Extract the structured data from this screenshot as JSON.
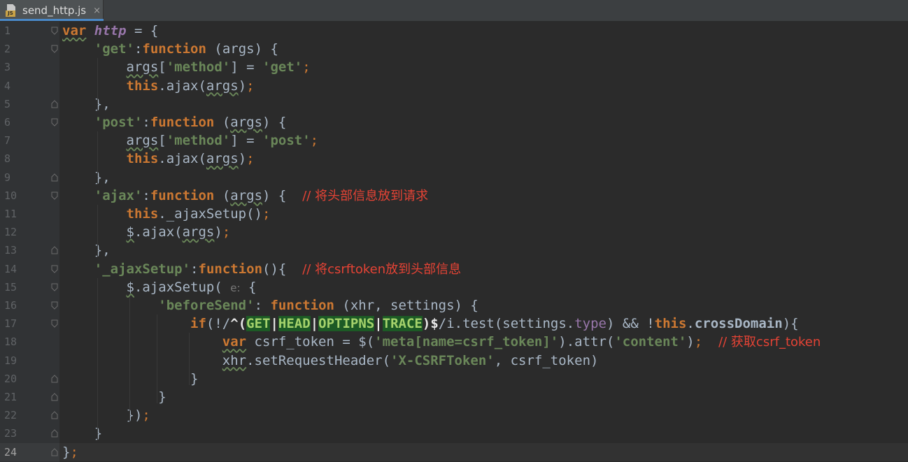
{
  "tab": {
    "filename": "send_http.js",
    "icon_badge": "JS",
    "close_glyph": "×"
  },
  "editor": {
    "current_line": 24,
    "lines": [
      {
        "n": "1",
        "tokens": [
          {
            "t": "var",
            "c": "kw wavy"
          },
          {
            "t": " "
          },
          {
            "t": "http",
            "c": "var"
          },
          {
            "t": " = {"
          }
        ]
      },
      {
        "n": "2",
        "tokens": [
          {
            "t": "    "
          },
          {
            "t": "'get'",
            "c": "str"
          },
          {
            "t": ":"
          },
          {
            "t": "function",
            "c": "kw"
          },
          {
            "t": " ("
          },
          {
            "t": "args"
          },
          {
            "t": ") {"
          }
        ]
      },
      {
        "n": "3",
        "tokens": [
          {
            "t": "        "
          },
          {
            "t": "args",
            "c": "wavy"
          },
          {
            "t": "["
          },
          {
            "t": "'method'",
            "c": "str"
          },
          {
            "t": "] = "
          },
          {
            "t": "'get'",
            "c": "str"
          },
          {
            "t": ";",
            "c": "kw2"
          }
        ]
      },
      {
        "n": "4",
        "tokens": [
          {
            "t": "        "
          },
          {
            "t": "this",
            "c": "kw"
          },
          {
            "t": ".ajax("
          },
          {
            "t": "args",
            "c": "wavy"
          },
          {
            "t": ")"
          },
          {
            "t": ";",
            "c": "kw2"
          }
        ]
      },
      {
        "n": "5",
        "tokens": [
          {
            "t": "    },"
          }
        ]
      },
      {
        "n": "6",
        "tokens": [
          {
            "t": "    "
          },
          {
            "t": "'post'",
            "c": "str"
          },
          {
            "t": ":"
          },
          {
            "t": "function",
            "c": "kw"
          },
          {
            "t": " ("
          },
          {
            "t": "args",
            "c": "wavy"
          },
          {
            "t": ") {"
          }
        ]
      },
      {
        "n": "7",
        "tokens": [
          {
            "t": "        "
          },
          {
            "t": "args",
            "c": "wavy"
          },
          {
            "t": "["
          },
          {
            "t": "'method'",
            "c": "str"
          },
          {
            "t": "] = "
          },
          {
            "t": "'post'",
            "c": "str"
          },
          {
            "t": ";",
            "c": "kw2"
          }
        ]
      },
      {
        "n": "8",
        "tokens": [
          {
            "t": "        "
          },
          {
            "t": "this",
            "c": "kw"
          },
          {
            "t": ".ajax("
          },
          {
            "t": "args",
            "c": "wavy"
          },
          {
            "t": ")"
          },
          {
            "t": ";",
            "c": "kw2"
          }
        ]
      },
      {
        "n": "9",
        "tokens": [
          {
            "t": "    },"
          }
        ]
      },
      {
        "n": "10",
        "tokens": [
          {
            "t": "    "
          },
          {
            "t": "'ajax'",
            "c": "str"
          },
          {
            "t": ":"
          },
          {
            "t": "function",
            "c": "kw"
          },
          {
            "t": " ("
          },
          {
            "t": "args",
            "c": "wavy"
          },
          {
            "t": ") {  "
          },
          {
            "t": "// 将头部信息放到请求",
            "c": "cmt"
          }
        ]
      },
      {
        "n": "11",
        "tokens": [
          {
            "t": "        "
          },
          {
            "t": "this",
            "c": "kw"
          },
          {
            "t": "._ajaxSetup()"
          },
          {
            "t": ";",
            "c": "kw2"
          }
        ]
      },
      {
        "n": "12",
        "tokens": [
          {
            "t": "        "
          },
          {
            "t": "$",
            "c": "wavy"
          },
          {
            "t": ".ajax("
          },
          {
            "t": "args",
            "c": "wavy"
          },
          {
            "t": ")"
          },
          {
            "t": ";",
            "c": "kw2"
          }
        ]
      },
      {
        "n": "13",
        "tokens": [
          {
            "t": "    },"
          }
        ]
      },
      {
        "n": "14",
        "tokens": [
          {
            "t": "    "
          },
          {
            "t": "'_ajaxSetup'",
            "c": "str"
          },
          {
            "t": ":"
          },
          {
            "t": "function",
            "c": "kw"
          },
          {
            "t": "(){  "
          },
          {
            "t": "// 将csrftoken放到头部信息",
            "c": "cmt"
          }
        ]
      },
      {
        "n": "15",
        "tokens": [
          {
            "t": "        "
          },
          {
            "t": "$",
            "c": "wavy"
          },
          {
            "t": ".ajaxSetup( "
          },
          {
            "t": "e:",
            "c": "hint"
          },
          {
            "t": " {"
          }
        ]
      },
      {
        "n": "16",
        "tokens": [
          {
            "t": "            "
          },
          {
            "t": "'beforeSend'",
            "c": "str"
          },
          {
            "t": ": "
          },
          {
            "t": "function",
            "c": "kw"
          },
          {
            "t": " (xhr, settings) {"
          }
        ]
      },
      {
        "n": "17",
        "tokens": [
          {
            "t": "                "
          },
          {
            "t": "if",
            "c": "kw"
          },
          {
            "t": "(!/"
          },
          {
            "t": "^(",
            "c": "rxp"
          },
          {
            "t": "GET",
            "c": "rx"
          },
          {
            "t": "|",
            "c": "rxp"
          },
          {
            "t": "HEAD",
            "c": "rx"
          },
          {
            "t": "|",
            "c": "rxp"
          },
          {
            "t": "OPTIPNS",
            "c": "rx"
          },
          {
            "t": "|",
            "c": "rxp"
          },
          {
            "t": "TRACE",
            "c": "rx"
          },
          {
            "t": ")$",
            "c": "rxp"
          },
          {
            "t": "/i.test(settings."
          },
          {
            "t": "type",
            "c": "fld"
          },
          {
            "t": ") && !"
          },
          {
            "t": "this",
            "c": "kw"
          },
          {
            "t": "."
          },
          {
            "t": "crossDomain",
            "c": "bold"
          },
          {
            "t": "){"
          }
        ]
      },
      {
        "n": "18",
        "tokens": [
          {
            "t": "                    "
          },
          {
            "t": "var",
            "c": "kw wavy"
          },
          {
            "t": " csrf_token = $("
          },
          {
            "t": "'meta[name=csrf_token]'",
            "c": "str"
          },
          {
            "t": ").attr("
          },
          {
            "t": "'content'",
            "c": "str"
          },
          {
            "t": ")"
          },
          {
            "t": ";",
            "c": "kw2"
          },
          {
            "t": "  "
          },
          {
            "t": "// 获取csrf_token",
            "c": "cmt"
          }
        ]
      },
      {
        "n": "19",
        "tokens": [
          {
            "t": "                    "
          },
          {
            "t": "xhr",
            "c": "wavy"
          },
          {
            "t": ".setRequestHeader("
          },
          {
            "t": "'X-CSRFToken'",
            "c": "str"
          },
          {
            "t": ", csrf_token)"
          }
        ]
      },
      {
        "n": "20",
        "tokens": [
          {
            "t": "                }"
          }
        ]
      },
      {
        "n": "21",
        "tokens": [
          {
            "t": "            }"
          }
        ]
      },
      {
        "n": "22",
        "tokens": [
          {
            "t": "        })"
          },
          {
            "t": ";",
            "c": "kw2"
          }
        ]
      },
      {
        "n": "23",
        "tokens": [
          {
            "t": "    }"
          }
        ]
      },
      {
        "n": "24",
        "tokens": [
          {
            "t": "}"
          },
          {
            "t": ";",
            "c": "kw2"
          }
        ]
      }
    ]
  },
  "colors": {
    "background": "#2b2b2b",
    "gutter": "#313335",
    "keyword": "#cc7832",
    "string": "#6a8759",
    "comment": "#e54335",
    "variable": "#9876aa"
  }
}
